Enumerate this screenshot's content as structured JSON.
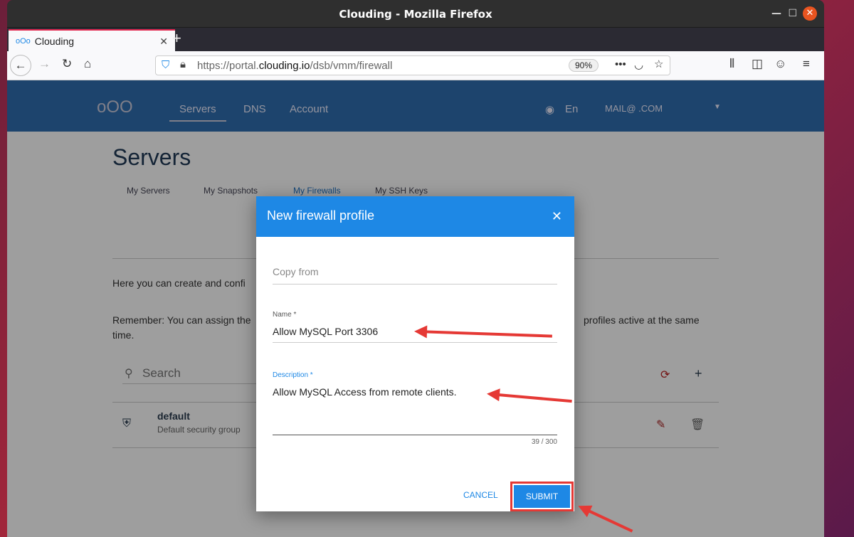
{
  "window": {
    "title": "Clouding - Mozilla Firefox"
  },
  "browser": {
    "tab_title": "Clouding",
    "url_prefix": "https://portal.",
    "url_domain": "clouding.io",
    "url_path": "/dsb/vmm/firewall",
    "zoom": "90%"
  },
  "site": {
    "nav": [
      "Servers",
      "DNS",
      "Account"
    ],
    "language": "En",
    "account": "MAIL@          .COM"
  },
  "page": {
    "title": "Servers",
    "tabs": [
      "My Servers",
      "My Snapshots",
      "My Firewalls",
      "My SSH Keys"
    ],
    "intro": "Here you can create and confi",
    "remember_left": "Remember: You can assign the",
    "remember_right": "profiles active at the same",
    "remember_end": "time.",
    "search_placeholder": "Search",
    "firewall": {
      "name": "default",
      "description": "Default security group"
    }
  },
  "dialog": {
    "title": "New firewall profile",
    "copy_from": "Copy from",
    "name_label": "Name *",
    "name_value": "Allow MySQL Port 3306",
    "desc_label": "Description *",
    "desc_value": "Allow MySQL Access from remote clients.",
    "counter": "39 / 300",
    "cancel": "CANCEL",
    "submit": "SUBMIT"
  }
}
